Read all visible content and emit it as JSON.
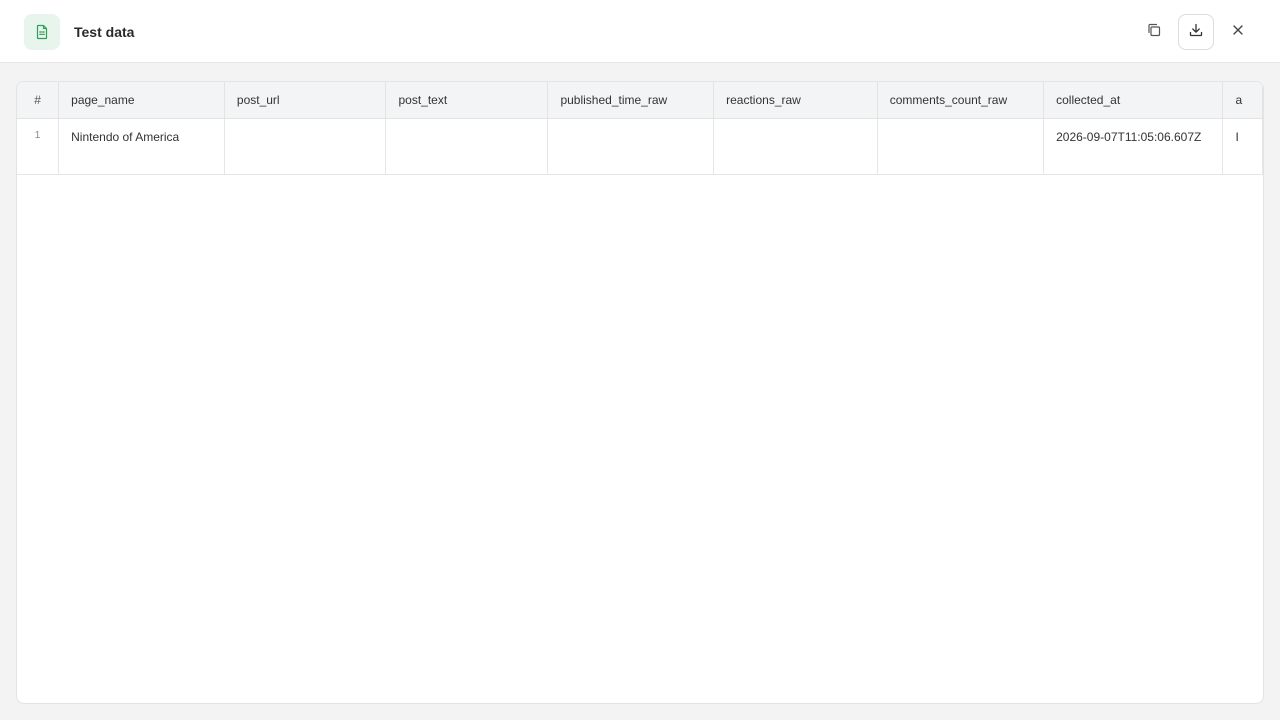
{
  "header": {
    "title": "Test data",
    "app_icon": "spreadsheet-icon",
    "buttons": {
      "copy_icon": "copy-icon",
      "download_icon": "download-icon",
      "close_icon": "close-icon"
    },
    "accent_color": "#2e9e5b"
  },
  "table": {
    "index_header": "#",
    "columns": [
      "page_name",
      "post_url",
      "post_text",
      "published_time_raw",
      "reactions_raw",
      "comments_count_raw",
      "collected_at",
      "a"
    ],
    "rows": [
      {
        "index": "1",
        "cells": [
          "Nintendo of America",
          "",
          "",
          "",
          "",
          "",
          "2026-09-07T11:05:06.607Z",
          "I"
        ]
      }
    ]
  }
}
